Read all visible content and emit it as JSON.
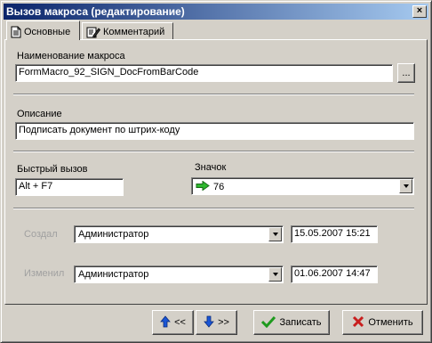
{
  "window": {
    "title": "Вызов макроса (редактирование)",
    "close": "×"
  },
  "tabs": [
    {
      "label": "Основные",
      "icon": "document-icon"
    },
    {
      "label": "Комментарий",
      "icon": "edit-note-icon"
    }
  ],
  "form": {
    "name_label": "Наименование макроса",
    "name_value": "FormMacro_92_SIGN_DocFromBarCode",
    "browse_label": "...",
    "description_label": "Описание",
    "description_value": "Подписать документ по штрих-коду",
    "hotkey_label": "Быстрый вызов",
    "hotkey_value": "Alt + F7",
    "icon_label": "Значок",
    "icon_value": "76",
    "icon_color": "#2eb82e",
    "created_label": "Создал",
    "created_by": "Администратор",
    "created_at": "15.05.2007 15:21",
    "modified_label": "Изменил",
    "modified_by": "Администратор",
    "modified_at": "01.06.2007 14:47"
  },
  "buttons": {
    "prev_label": "<<",
    "next_label": ">>",
    "save_label": "Записать",
    "cancel_label": "Отменить",
    "nav_arrow_color": "#1a56d6",
    "save_check_color": "#1e9a1e",
    "cancel_x_color": "#c81e1e"
  }
}
